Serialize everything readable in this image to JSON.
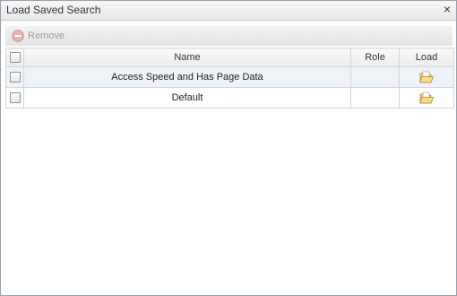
{
  "window": {
    "title": "Load Saved Search",
    "close_glyph": "×"
  },
  "toolbar": {
    "remove_label": "Remove",
    "remove_icon": "remove-circle-icon"
  },
  "grid": {
    "columns": {
      "select": "",
      "name": "Name",
      "role": "Role",
      "load": "Load"
    },
    "rows": [
      {
        "name": "Access Speed and Has Page Data",
        "role": "",
        "load_icon": "open-folder-icon"
      },
      {
        "name": "Default",
        "role": "",
        "load_icon": "open-folder-icon"
      }
    ]
  },
  "colors": {
    "accent_icon": "#e8b84a",
    "remove_icon": "#d9a0a0",
    "alt_row": "#eef3fa"
  }
}
